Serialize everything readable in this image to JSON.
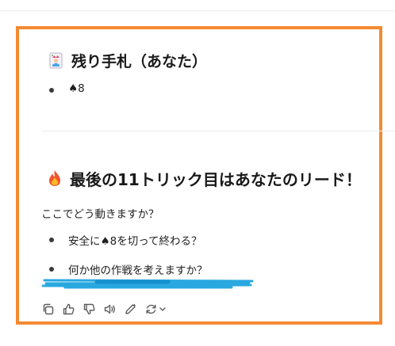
{
  "remaining_hand": {
    "heading": "残り手札（あなた）",
    "icon": "joker-card-icon",
    "cards": [
      "♠8"
    ]
  },
  "lead_section": {
    "heading": "最後の11トリック目はあなたのリード！",
    "icon": "fire-icon",
    "question": "ここでどう動きますか？",
    "options": [
      "安全に♠8を切って終わる？",
      "何か他の作戦を考えますか？"
    ]
  },
  "toolbar": {
    "icons": [
      "copy-icon",
      "thumbs-up-icon",
      "thumbs-down-icon",
      "read-aloud-icon",
      "edit-icon",
      "regenerate-icon"
    ]
  },
  "colors": {
    "frame": "#f58a32",
    "highlight_scribble": "#29a8e0"
  }
}
